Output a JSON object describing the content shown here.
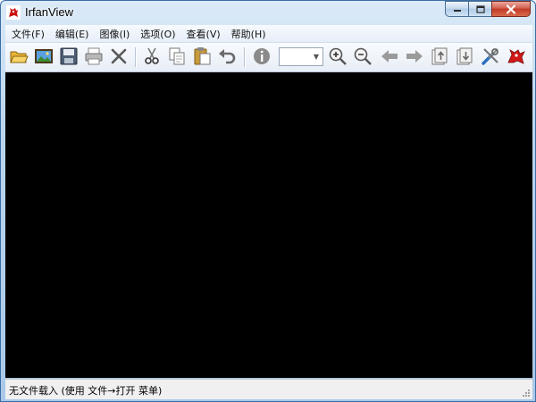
{
  "window": {
    "title": "IrfanView"
  },
  "menu": {
    "items": [
      "文件(F)",
      "编辑(E)",
      "图像(I)",
      "选项(O)",
      "查看(V)",
      "帮助(H)"
    ]
  },
  "toolbar": {
    "icons": [
      "open-folder-icon",
      "slideshow-icon",
      "save-icon",
      "print-icon",
      "delete-icon",
      "cut-icon",
      "copy-icon",
      "paste-icon",
      "undo-icon",
      "info-icon",
      "zoom-in-icon",
      "zoom-out-icon",
      "previous-icon",
      "next-icon",
      "previous-page-icon",
      "next-page-icon",
      "properties-icon",
      "irfanview-logo-icon"
    ],
    "zoom_value": ""
  },
  "status": {
    "text": "无文件载入 (使用 文件→打开 菜单)"
  },
  "colors": {
    "canvas_bg": "#000000",
    "close_button": "#c13a28",
    "title_gradient": "#a9c8e8"
  }
}
